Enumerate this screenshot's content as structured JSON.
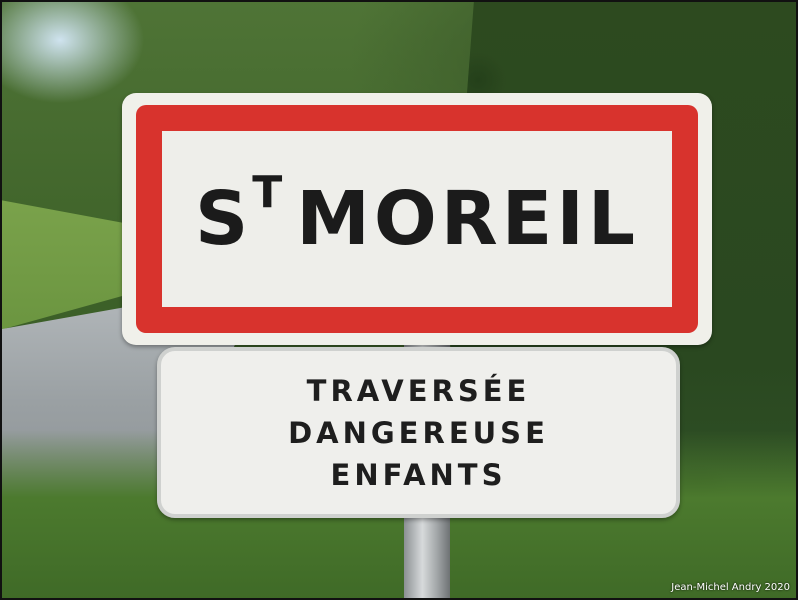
{
  "sign": {
    "town_prefix": "S",
    "town_prefix_sup": "T",
    "town_name": "MOREIL",
    "border_color": "#d8332d",
    "panel_color": "#eeeeea"
  },
  "sub_sign": {
    "lines": [
      "TRAVERSÉE",
      "DANGEREUSE",
      "ENFANTS"
    ]
  },
  "credit": "Jean-Michel Andry 2020"
}
